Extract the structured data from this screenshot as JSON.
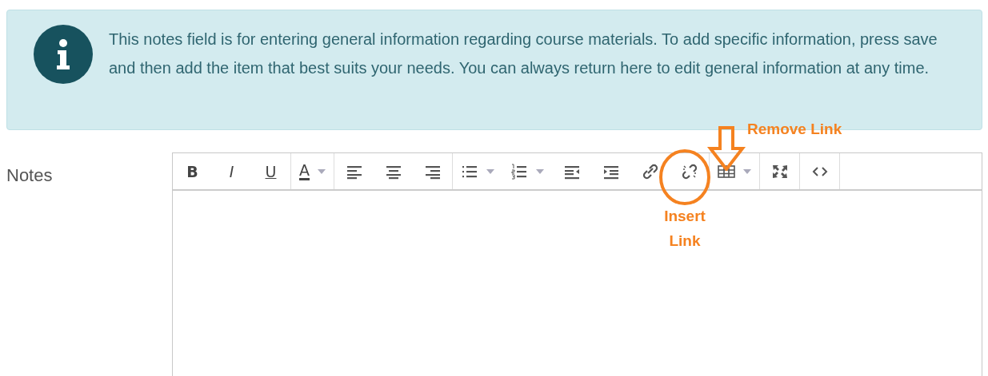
{
  "info_box": {
    "text": "This notes field is for entering general information regarding course materials. To add specific information, press save and then add the item that best suits your needs. You can always return here to edit general information at any time."
  },
  "notes": {
    "label": "Notes",
    "toolbar": [
      {
        "buttons": [
          {
            "label": "B",
            "dropdown": false
          },
          {
            "label": "I",
            "dropdown": false
          },
          {
            "label": "U",
            "dropdown": false
          }
        ]
      },
      {
        "buttons": [
          {
            "label": "A",
            "dropdown": true
          }
        ]
      },
      {
        "buttons": [
          {
            "dropdown": false
          },
          {
            "dropdown": false
          },
          {
            "dropdown": false
          }
        ]
      },
      {
        "buttons": [
          {
            "dropdown": true
          },
          {
            "dropdown": true
          },
          {
            "dropdown": false
          },
          {
            "dropdown": false
          },
          {
            "dropdown": false
          },
          {
            "dropdown": false
          }
        ]
      },
      {
        "buttons": [
          {
            "dropdown": true
          }
        ]
      },
      {
        "buttons": [
          {
            "dropdown": false
          }
        ]
      },
      {
        "buttons": [
          {
            "dropdown": false
          }
        ]
      }
    ]
  },
  "annotations": [
    {
      "kind": "arrow",
      "label": "Remove Link"
    },
    {
      "kind": "circle",
      "label": "Insert Link"
    }
  ]
}
